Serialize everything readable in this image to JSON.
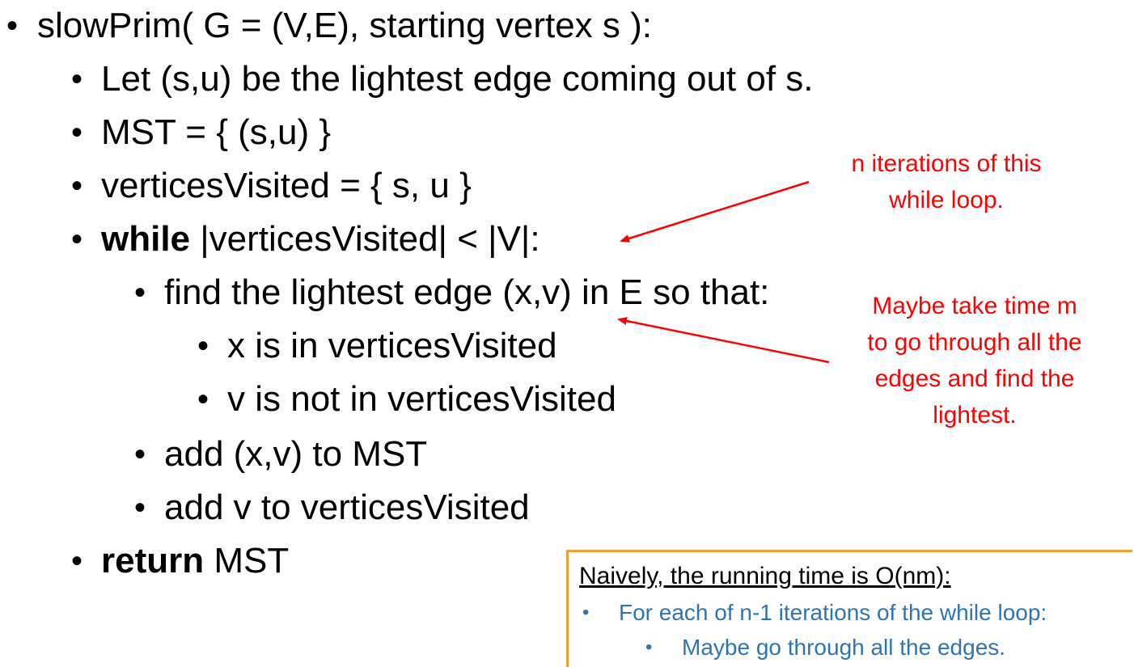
{
  "algorithm": {
    "signature": "slowPrim( G = (V,E), starting vertex s ):",
    "step1": "Let (s,u) be the lightest edge coming out of s.",
    "step2": "MST = { (s,u) }",
    "step3": "verticesVisited = { s, u }",
    "while_keyword": "while",
    "while_condition": " |verticesVisited| < |V|:",
    "find_edge": "find the lightest edge (x,v) in E so that:",
    "cond1": "x is in verticesVisited",
    "cond2": "v is not in verticesVisited",
    "add_edge": "add (x,v) to MST",
    "add_vertex": "add v to verticesVisited",
    "return_keyword": "return",
    "return_value": " MST"
  },
  "annotations": {
    "while_note_line1": "n iterations of this",
    "while_note_line2": "while loop.",
    "find_note_line1": "Maybe take time m",
    "find_note_line2": "to go through all the",
    "find_note_line3": "edges and find the",
    "find_note_line4": "lightest."
  },
  "summary_box": {
    "title": "Naively, the running time is O(nm):",
    "item1": "For each of n-1 iterations of the while loop:",
    "item2": "Maybe go through all the edges."
  },
  "colors": {
    "annotation": "#ff0000",
    "box_border": "#f0a030",
    "box_text": "#2e75b6"
  }
}
